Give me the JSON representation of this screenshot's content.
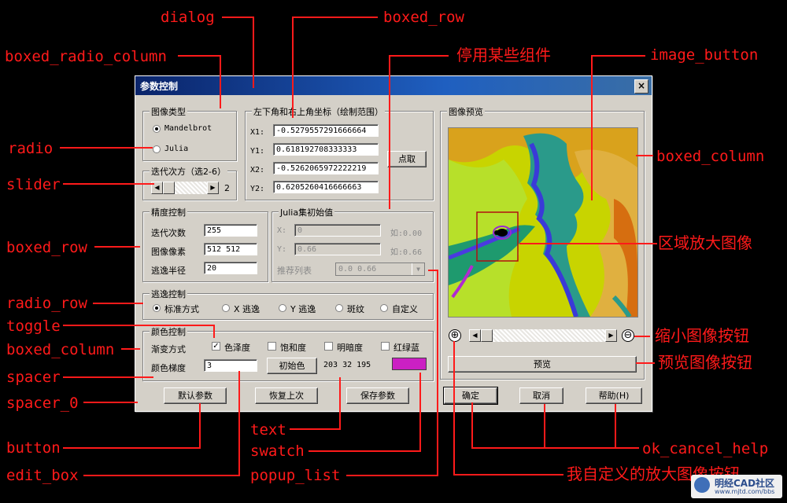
{
  "annotations": {
    "dialog": "dialog",
    "boxed_row_top": "boxed_row",
    "disable_some": "停用某些组件",
    "boxed_radio_column": "boxed_radio_column",
    "image_button": "image_button",
    "radio": "radio",
    "boxed_column_right": "boxed_column",
    "slider": "slider",
    "boxed_row_left": "boxed_row",
    "region_zoom": "区域放大图像",
    "radio_row": "radio_row",
    "toggle": "toggle",
    "zoom_out_btn": "缩小图像按钮",
    "boxed_column_left": "boxed_column",
    "preview_btn": "预览图像按钮",
    "spacer": "spacer",
    "spacer_0": "spacer_0",
    "text": "text",
    "button": "button",
    "swatch": "swatch",
    "ok_cancel_help": "ok_cancel_help",
    "edit_box": "edit_box",
    "popup_list": "popup_list",
    "custom_zoom_btn": "我自定义的放大图像按钮"
  },
  "dialog": {
    "title": "参数控制",
    "close": "×"
  },
  "image_type": {
    "caption": "图像类型",
    "opt1": "Mandelbrot",
    "opt2": "Julia",
    "selected": "Mandelbrot"
  },
  "iter_power": {
    "caption": "迭代次方（选2-6）",
    "value": "2"
  },
  "coords": {
    "caption": "左下角和右上角坐标（绘制范围）",
    "x1_label": "X1:",
    "x1": "-0.5279557291666664",
    "y1_label": "Y1:",
    "y1": "0.618192708333333",
    "x2_label": "X2:",
    "x2": "-0.5262065972222219",
    "y2_label": "Y2:",
    "y2": "0.6205260416666663",
    "pick_button": "点取"
  },
  "precision": {
    "caption": "精度控制",
    "iter_label": "迭代次数",
    "iter_value": "255",
    "pixels_label": "图像像素",
    "pixels_value": "512 512",
    "escape_label": "逃逸半径",
    "escape_value": "20"
  },
  "julia": {
    "caption": "Julia集初始值",
    "x_label": "X:",
    "x_value": "0",
    "x_hint": "如:0.00",
    "y_label": "Y:",
    "y_value": "0.66",
    "y_hint": "如:0.66",
    "list_label": "推荐列表",
    "list_value": "0.0 0.66"
  },
  "escape": {
    "caption": "逃逸控制",
    "opt1": "标准方式",
    "opt2": "X 逃逸",
    "opt3": "Y 逃逸",
    "opt4": "斑纹",
    "opt5": "自定义",
    "selected": "标准方式"
  },
  "color": {
    "caption": "颜色控制",
    "gradient_label": "渐变方式",
    "hue": "色泽度",
    "hue_checked": true,
    "sat": "饱和度",
    "bright": "明暗度",
    "rgb": "红绿蓝",
    "gradient_step_label": "颜色梯度",
    "gradient_step": "3",
    "init_button": "初始色",
    "rgb_text": "203 32 195",
    "swatch_color": "#cb20c3"
  },
  "preview": {
    "caption": "图像预览",
    "button": "预览"
  },
  "buttons": {
    "defaults": "默认参数",
    "restore": "恢复上次",
    "save": "保存参数",
    "ok": "确定",
    "cancel": "取消",
    "help": "帮助(H)"
  },
  "logo": {
    "name": "明经CAD社区",
    "url": "www.mjtd.com/bbs"
  },
  "colors": {
    "annotation": "#ff1a1a",
    "dialog_bg": "#d4d0c8",
    "title_bar": "#0a246a"
  }
}
